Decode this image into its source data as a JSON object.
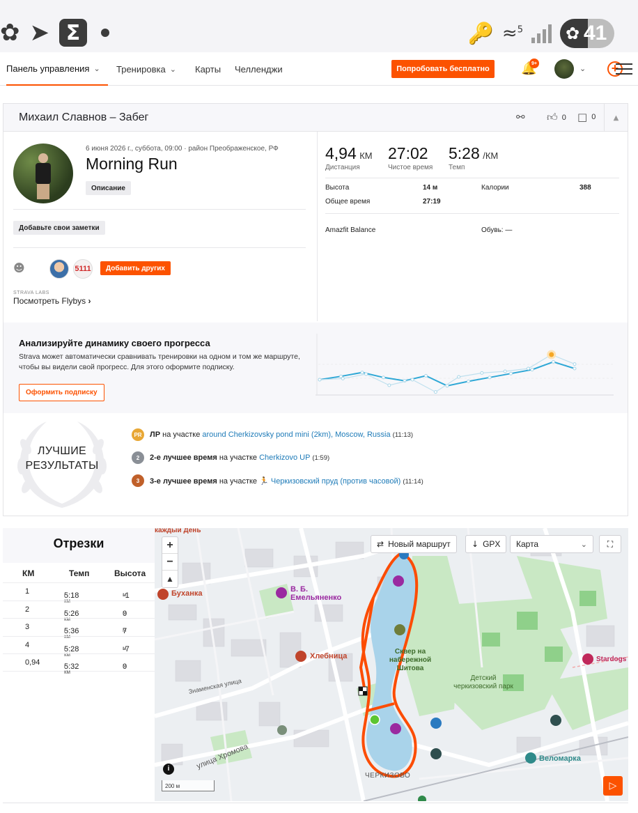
{
  "statusbar": {
    "wifi_count": "5",
    "battery": "41"
  },
  "nav": {
    "items": [
      {
        "label": "Панель управления"
      },
      {
        "label": "Тренировка"
      },
      {
        "label": "Карты"
      },
      {
        "label": "Челленджи"
      }
    ],
    "try_button": "Попробовать бесплатно",
    "notification_badge": "9+"
  },
  "activity": {
    "header_title": "Михаил Славнов – Забег",
    "kudos_count": "0",
    "comments_count": "0",
    "meta": "6 июня 2026 г., суббота, 09:00 · район Преображенское, РФ",
    "name": "Morning Run",
    "description_label": "Описание",
    "notes_label": "Добавьте свои заметки",
    "avatar2_text": "5111",
    "add_others_label": "Добавить других",
    "labs_label": "STRAVA LABS",
    "flybys_label": "Посмотреть Flybys"
  },
  "stats": {
    "distance": {
      "value": "4,94",
      "unit": "КМ",
      "label": "Дистанция"
    },
    "moving_time": {
      "value": "27:02",
      "label": "Чистое время"
    },
    "pace": {
      "value": "5:28",
      "unit": "/КМ",
      "label": "Темп"
    },
    "elevation_label": "Высота",
    "elevation_value": "14 м",
    "calories_label": "Калории",
    "calories_value": "388",
    "elapsed_label": "Общее время",
    "elapsed_value": "27:19",
    "device": "Amazfit Balance",
    "shoes": "Обувь: —"
  },
  "analyze": {
    "title": "Анализируйте динамику своего прогресса",
    "text": "Strava может автоматически сравнивать тренировки на одном и том же маршруте, чтобы вы видели свой прогресс. Для этого оформите подписку.",
    "button": "Оформить подписку"
  },
  "chart_data": {
    "type": "line",
    "title": "",
    "series": [
      {
        "values": [
          0.4,
          0.46,
          0.53,
          0.44,
          0.38,
          0.47,
          0.29,
          0.37,
          0.44,
          0.51,
          0.58,
          0.72,
          0.6
        ]
      },
      {
        "values": [
          0.4,
          0.42,
          0.5,
          0.3,
          0.4,
          0.18,
          0.45,
          0.52,
          0.55,
          0.6,
          0.85,
          0.68
        ]
      }
    ],
    "highlight_index": 11,
    "colors": {
      "line": "#2fa8d6",
      "highlight": "#f5a623"
    }
  },
  "best_efforts": {
    "wreath_title_line1": "ЛУЧШИЕ",
    "wreath_title_line2": "РЕЗУЛЬТАТЫ",
    "rows": [
      {
        "medal": "PR",
        "bold": "ЛР",
        "mid": "на участке",
        "link": "around Cherkizovsky pond mini (2km), Moscow, Russia",
        "time": "(11:13)"
      },
      {
        "medal": "2",
        "bold": "2-е лучшее время",
        "mid": "на участке",
        "link": "Cherkizovo UP",
        "time": "(1:59)"
      },
      {
        "medal": "3",
        "bold": "3-е лучшее время",
        "mid": "на участке",
        "link": "🏃 Черкизовский пруд (против часовой)",
        "time": "(11:14)"
      }
    ],
    "medal_colors": {
      "pr": "#e8a735",
      "second": "#8a8f96",
      "third": "#c0602a"
    }
  },
  "splits": {
    "title": "Отрезки",
    "headers": [
      "КМ",
      "Темп",
      "Высота"
    ],
    "pace_unit": "/км",
    "elev_unit": "м",
    "rows": [
      {
        "km": "1",
        "pace": "5:18",
        "elev": "-1"
      },
      {
        "km": "2",
        "pace": "5:26",
        "elev": "0"
      },
      {
        "km": "3",
        "pace": "5:36",
        "elev": "7"
      },
      {
        "km": "4",
        "pace": "5:28",
        "elev": "-7"
      },
      {
        "km": "0,94",
        "pace": "5:32",
        "elev": "0"
      }
    ]
  },
  "map": {
    "new_route": "Новый маршрут",
    "gpx": "GPX",
    "layer_select": "Карта",
    "labels": {
      "every_day": "каждый День",
      "bukhanka": "Буханка",
      "emelyanenko": "В. Б. Емельяненко",
      "khlebnitsa": "Хлебница",
      "znamenskaya": "Знаменская улица",
      "khromova": "улица Хромова",
      "skver": "Сквер на набережной Шитова",
      "park": "Детский черкизовский парк",
      "stardogs": "Stardogs",
      "velomarka": "Веломарка",
      "cherkizovo": "ЧЕРКИЗОВО",
      "scale": "200 м"
    }
  }
}
